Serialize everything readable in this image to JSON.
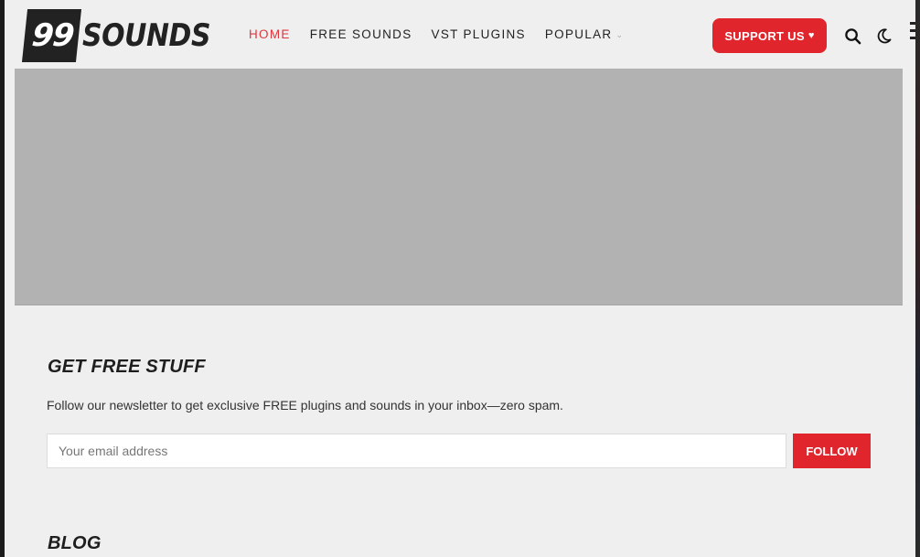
{
  "logo": {
    "number": "99",
    "word": "SOUNDS"
  },
  "nav": {
    "items": [
      {
        "label": "HOME",
        "active": true
      },
      {
        "label": "FREE SOUNDS"
      },
      {
        "label": "VST PLUGINS"
      },
      {
        "label": "POPULAR",
        "has_dropdown": true
      }
    ],
    "dropdown_icon": "chevron-down-icon"
  },
  "header_actions": {
    "support_label": "SUPPORT US",
    "support_icon": "heart-icon",
    "search_icon": "search-icon",
    "theme_icon": "moon-icon"
  },
  "newsletter": {
    "title": "GET FREE STUFF",
    "description": "Follow our newsletter to get exclusive FREE plugins and sounds in your inbox—zero spam.",
    "email_placeholder": "Your email address",
    "button_label": "FOLLOW"
  },
  "blog": {
    "title": "BLOG"
  },
  "colors": {
    "accent": "#e0252d",
    "page_bg": "#efeff0",
    "banner_placeholder": "#b3b2b3",
    "text": "#222222"
  }
}
